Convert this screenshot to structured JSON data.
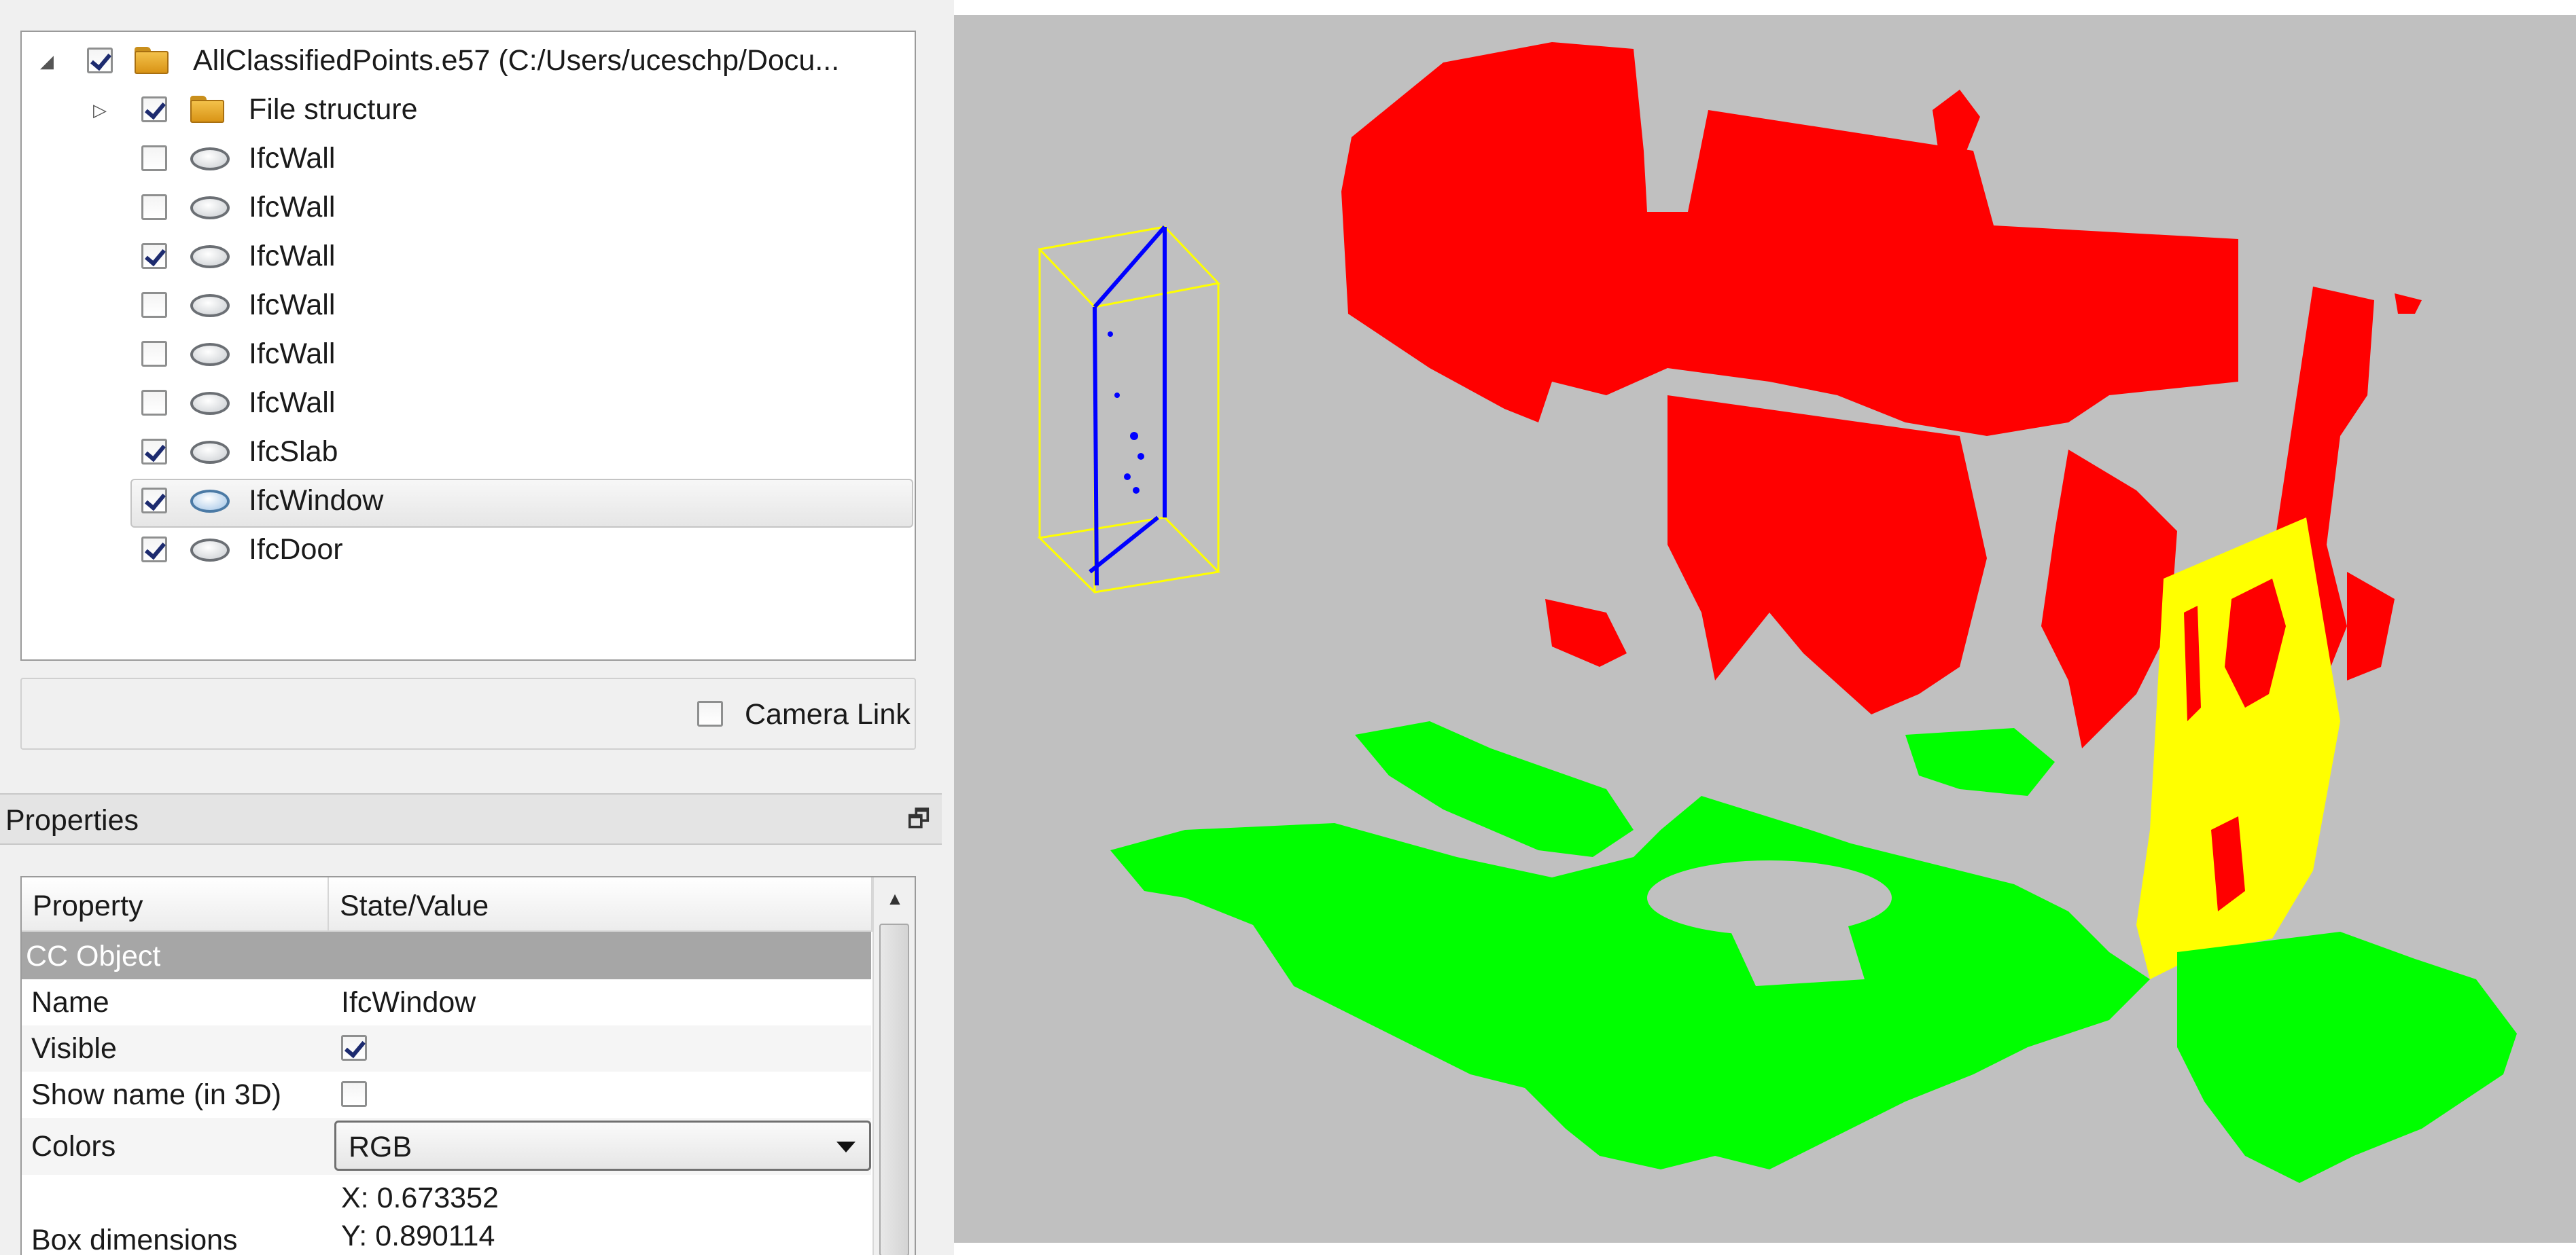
{
  "tree": {
    "root": {
      "label": "AllClassifiedPoints.e57 (C:/Users/uceschp/Docu...",
      "checked": true,
      "expanded": true
    },
    "items": [
      {
        "label": "File structure",
        "type": "folder",
        "checked": true
      },
      {
        "label": "IfcWall",
        "type": "cloud",
        "checked": false
      },
      {
        "label": "IfcWall",
        "type": "cloud",
        "checked": false
      },
      {
        "label": "IfcWall",
        "type": "cloud",
        "checked": true
      },
      {
        "label": "IfcWall",
        "type": "cloud",
        "checked": false
      },
      {
        "label": "IfcWall",
        "type": "cloud",
        "checked": false
      },
      {
        "label": "IfcWall",
        "type": "cloud",
        "checked": false
      },
      {
        "label": "IfcSlab",
        "type": "cloud",
        "checked": true
      },
      {
        "label": "IfcWindow",
        "type": "cloud",
        "checked": true,
        "selected": true
      },
      {
        "label": "IfcDoor",
        "type": "cloud",
        "checked": true
      }
    ]
  },
  "camera_link": {
    "label": "Camera Link",
    "checked": false
  },
  "properties": {
    "title": "Properties",
    "columns": {
      "property": "Property",
      "value": "State/Value"
    },
    "section": "CC Object",
    "name": {
      "label": "Name",
      "value": "IfcWindow"
    },
    "visible": {
      "label": "Visible",
      "checked": true
    },
    "show_name": {
      "label": "Show name (in 3D)",
      "checked": false
    },
    "colors": {
      "label": "Colors",
      "value": "RGB"
    },
    "box_dimensions": {
      "label": "Box dimensions",
      "x": "X: 0.673352",
      "y": "Y: 0.890114"
    }
  },
  "viewport": {
    "background": "#c0c0c0",
    "classes": [
      {
        "name": "IfcWall",
        "color": "#ff0000"
      },
      {
        "name": "IfcSlab",
        "color": "#00ff00"
      },
      {
        "name": "IfcDoor",
        "color": "#ffff00"
      },
      {
        "name": "IfcWindow",
        "color": "#0000ff"
      }
    ],
    "bbox_color": "#ffff00"
  }
}
